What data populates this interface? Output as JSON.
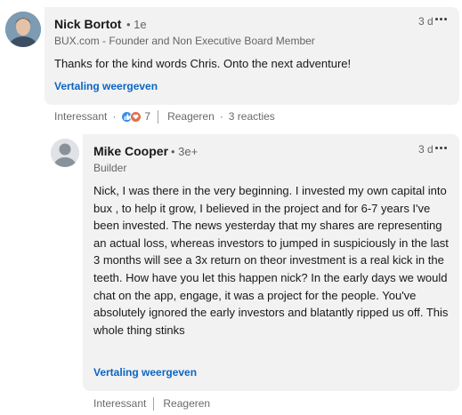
{
  "comment": {
    "author": "Nick Bortot",
    "degree": "• 1e",
    "headline": "BUX.com - Founder and Non Executive Board Member",
    "time": "3 d",
    "text": "Thanks for the kind words Chris. Onto the next adventure!",
    "translate_label": "Vertaling weergeven",
    "actions": {
      "like_label": "Interessant",
      "reaction_count": "7",
      "reply_label": "Reageren",
      "replies_label": "3 reacties"
    }
  },
  "reply": {
    "author": "Mike Cooper",
    "degree": "• 3e+",
    "headline": "Builder",
    "time": "3 d",
    "text": "Nick, I was there in the very beginning. I invested my own capital into bux , to help it grow, I believed in the project and for 6-7 years I've been invested. The news yesterday that my shares are representing an actual loss, whereas investors to jumped in suspiciously in the last 3 months will see  a 3x return on theor investment is a real kick in the teeth. How have you let this happen nick? In the early days we would chat on the app, engage, it was a project for the people. You've absolutely ignored the early investors and blatantly ripped us off. This whole thing stinks",
    "translate_label": "Vertaling weergeven",
    "actions": {
      "like_label": "Interessant",
      "reply_label": "Reageren"
    }
  },
  "icons": [
    "avatar-photo",
    "avatar-placeholder",
    "more-options-icon",
    "like-reaction-icon",
    "love-reaction-icon"
  ],
  "colors": {
    "link": "#0a66c2",
    "bubble": "#f2f2f2",
    "like": "#378fe9",
    "love": "#df704d"
  }
}
